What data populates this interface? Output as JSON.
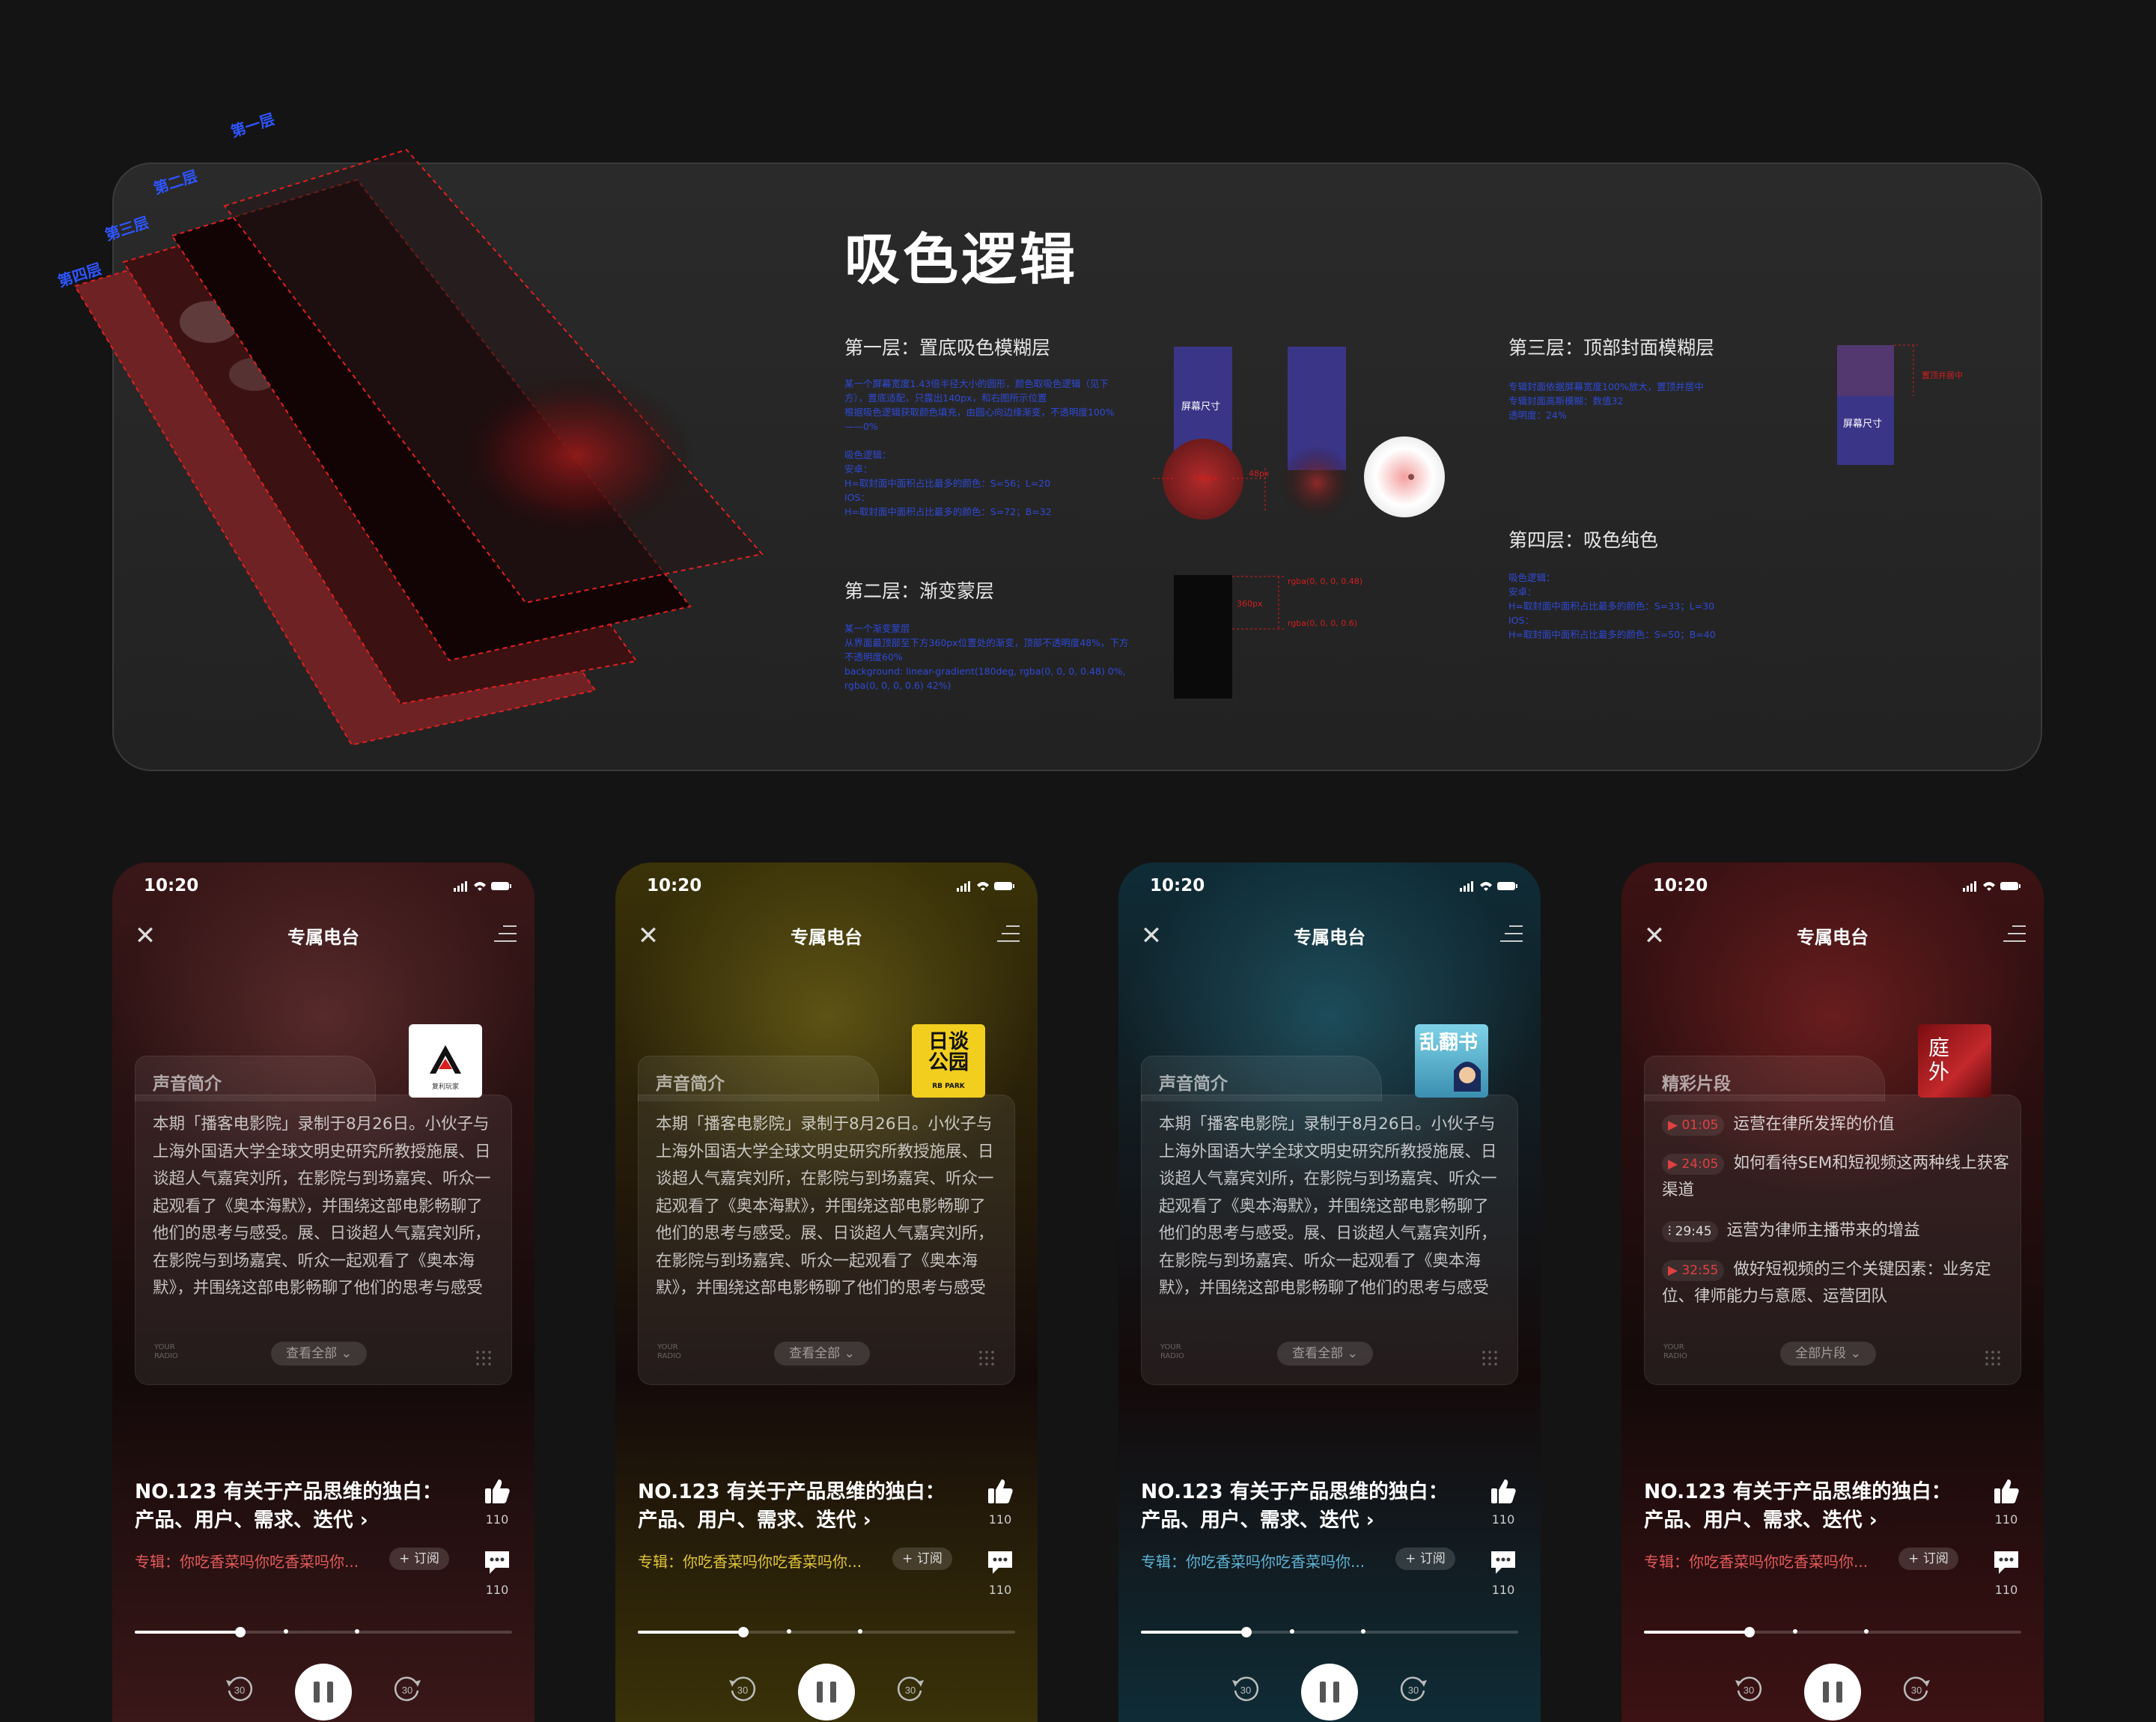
{
  "infographic": {
    "title": "吸色逻辑",
    "layer_labels": [
      "第一层",
      "第二层",
      "第三层",
      "第四层"
    ],
    "layer1": {
      "title": "第一层：置底吸色模糊层",
      "desc": "某一个屏幕宽度1.43倍半径大小的圆形，颜色取吸色逻辑（见下方），置底适配，只露出140px，和右图所示位置\n根据吸色逻辑获取颜色填充，由圆心向边缘渐变，不透明度100%——0%\n\n吸色逻辑：\n安卓：\nH=取封面中面积占比最多的颜色：S=56；L=20\nIOS：\nH=取封面中面积占比最多的颜色：S=72；B=32",
      "screen_label": "屏幕尺寸",
      "px140": "140px",
      "dim": "48px"
    },
    "layer2": {
      "title": "第二层：渐变蒙层",
      "desc": "某一个渐变蒙层\n从界面最顶部至下方360px位置处的渐变，顶部不透明度48%，下方不透明度60%\nbackground: linear-gradient(180deg, rgba(0, 0, 0, 0.48) 0%, rgba(0, 0, 0, 0.6) 42%)",
      "h360": "360px",
      "rgba_top": "rgba(0, 0, 0, 0.48)",
      "rgba_bottom": "rgba(0, 0, 0, 0.6)"
    },
    "layer3": {
      "title": "第三层：顶部封面模糊层",
      "desc": "专辑封面依据屏幕宽度100%放大，置顶并居中\n专辑封面高斯模糊：数值32\n透明度：24%",
      "screen_label": "屏幕尺寸",
      "top_center": "置顶并居中"
    },
    "layer4": {
      "title": "第四层：吸色纯色",
      "desc": "吸色逻辑：\n安卓：\nH=取封面中面积占比最多的颜色：S=33；L=30\nIOS：\nH=取封面中面积占比最多的颜色：S=50；B=40"
    }
  },
  "colors": {
    "phone1": "#3a1718",
    "phone2": "#3a3208",
    "phone3": "#0f2c36",
    "phone4": "#3d1214",
    "album_red": "#e45a5a",
    "album_yellow": "#e0c53a",
    "album_teal": "#5fb3d6"
  },
  "phones": [
    {
      "time": "10:20",
      "nav_title": "专属电台",
      "card_title": "声音简介",
      "card_body": "本期「播客电影院」录制于8月26日。小伙子与上海外国语大学全球文明史研究所教授施展、日谈超人气嘉宾刘所，在影院与到场嘉宾、听众一起观看了《奥本海默》，并围绕这部电影畅聊了他们的思考与感受。展、日谈超人气嘉宾刘所，在影院与到场嘉宾、听众一起观看了《奥本海默》，并围绕这部电影畅聊了他们的思考与感受",
      "see_all": "查看全部 ⌄",
      "radio_mark": "YOUR\nRADIO",
      "thumb_text": "复利玩家",
      "ep_title": "NO.123 有关于产品思维的独白：产品、用户、需求、迭代 ›",
      "album": "专辑：你吃香菜吗你吃香菜吗你...",
      "subscribe": "+ 订阅",
      "likes": "110",
      "comments": "110",
      "skip_back": "30",
      "skip_fwd": "30",
      "progress": 0.28
    },
    {
      "time": "10:20",
      "nav_title": "专属电台",
      "card_title": "声音简介",
      "card_body": "本期「播客电影院」录制于8月26日。小伙子与上海外国语大学全球文明史研究所教授施展、日谈超人气嘉宾刘所，在影院与到场嘉宾、听众一起观看了《奥本海默》，并围绕这部电影畅聊了他们的思考与感受。展、日谈超人气嘉宾刘所，在影院与到场嘉宾、听众一起观看了《奥本海默》，并围绕这部电影畅聊了他们的思考与感受",
      "see_all": "查看全部 ⌄",
      "radio_mark": "YOUR\nRADIO",
      "thumb_text": "日谈公园",
      "thumb_sub": "RB PARK",
      "ep_title": "NO.123 有关于产品思维的独白：产品、用户、需求、迭代 ›",
      "album": "专辑：你吃香菜吗你吃香菜吗你...",
      "subscribe": "+ 订阅",
      "likes": "110",
      "comments": "110",
      "skip_back": "30",
      "skip_fwd": "30",
      "progress": 0.28
    },
    {
      "time": "10:20",
      "nav_title": "专属电台",
      "card_title": "声音简介",
      "card_body": "本期「播客电影院」录制于8月26日。小伙子与上海外国语大学全球文明史研究所教授施展、日谈超人气嘉宾刘所，在影院与到场嘉宾、听众一起观看了《奥本海默》，并围绕这部电影畅聊了他们的思考与感受。展、日谈超人气嘉宾刘所，在影院与到场嘉宾、听众一起观看了《奥本海默》，并围绕这部电影畅聊了他们的思考与感受",
      "see_all": "查看全部 ⌄",
      "radio_mark": "YOUR\nRADIO",
      "thumb_text": "乱翻书",
      "ep_title": "NO.123 有关于产品思维的独白：产品、用户、需求、迭代 ›",
      "album": "专辑：你吃香菜吗你吃香菜吗你...",
      "subscribe": "+ 订阅",
      "likes": "110",
      "comments": "110",
      "skip_back": "30",
      "skip_fwd": "30",
      "progress": 0.28
    },
    {
      "time": "10:20",
      "nav_title": "专属电台",
      "card_title": "精彩片段",
      "segments": [
        {
          "time": "01:05",
          "text": "运营在律所发挥的价值"
        },
        {
          "time": "24:05",
          "text": "如何看待SEM和短视频这两种线上获客渠道"
        },
        {
          "time": "29:45",
          "text": "运营为律师主播带来的增益"
        },
        {
          "time": "32:55",
          "text": "做好短视频的三个关键因素：业务定位、律师能力与意愿、运营团队"
        }
      ],
      "see_all": "全部片段 ⌄",
      "radio_mark": "YOUR\nRADIO",
      "thumb_text": "庭外",
      "ep_title": "NO.123 有关于产品思维的独白：产品、用户、需求、迭代 ›",
      "album": "专辑：你吃香菜吗你吃香菜吗你...",
      "subscribe": "+ 订阅",
      "likes": "110",
      "comments": "110",
      "skip_back": "30",
      "skip_fwd": "30",
      "progress": 0.28
    }
  ]
}
